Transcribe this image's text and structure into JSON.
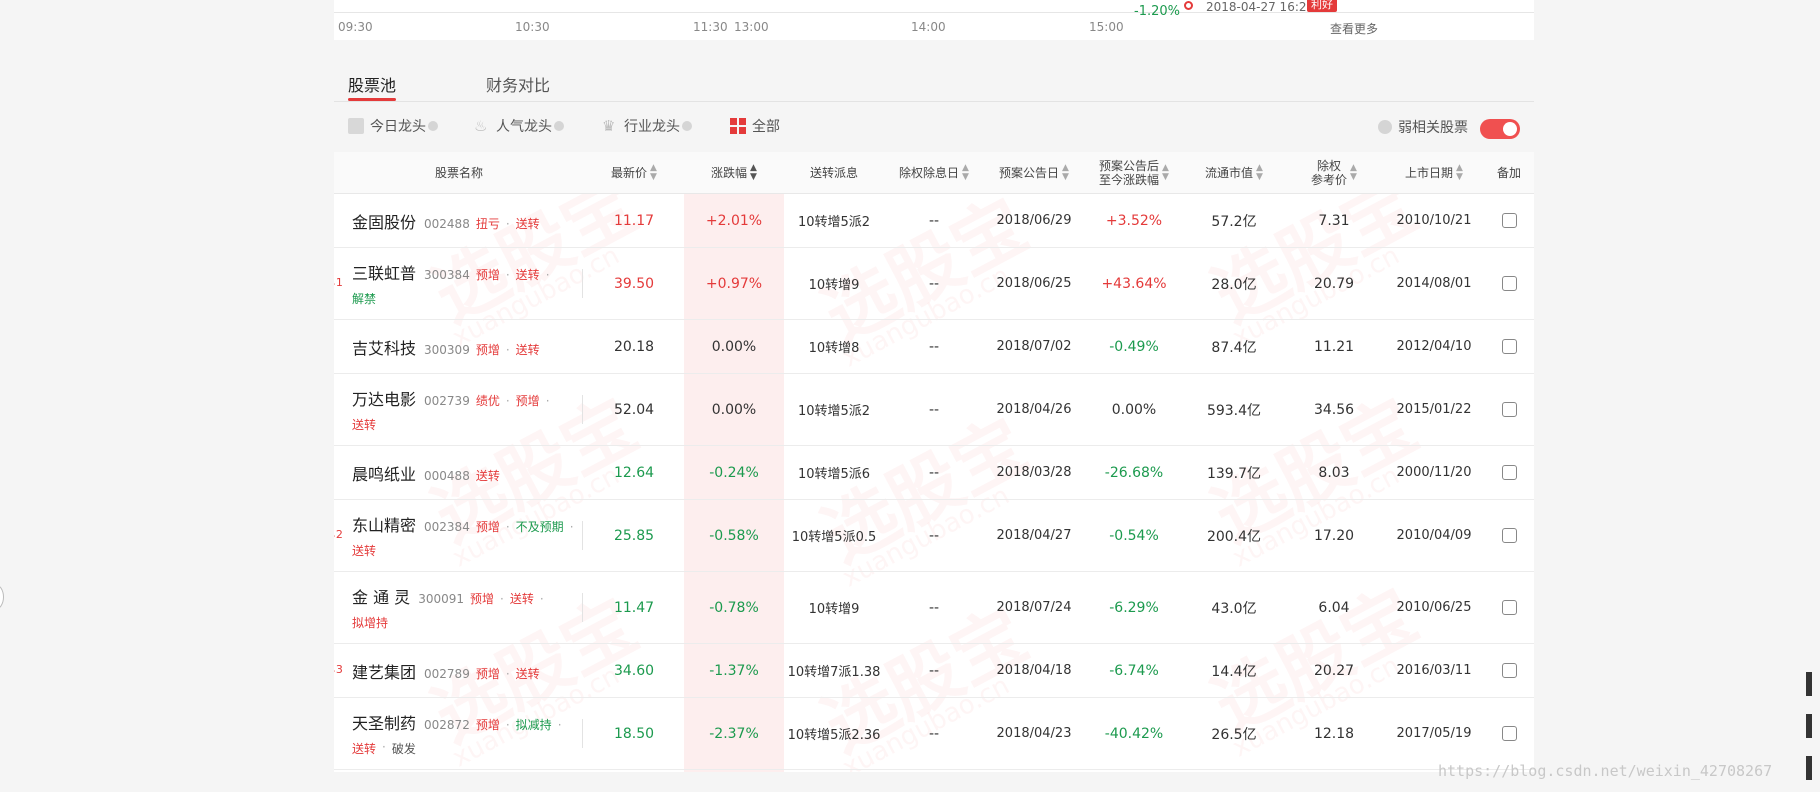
{
  "chart_strip": {
    "time_ticks": [
      "09:30",
      "10:30",
      "11:30",
      "13:00",
      "14:00",
      "15:00"
    ],
    "news": {
      "change": "-1.20%",
      "time": "2018-04-27 16:26",
      "badge": "利好"
    },
    "view_more": "查看更多"
  },
  "tabs": [
    {
      "label": "股票池",
      "active": true
    },
    {
      "label": "财务对比",
      "active": false
    }
  ],
  "filters": {
    "items": [
      {
        "label": "今日龙头",
        "icon": "box-icon"
      },
      {
        "label": "人气龙头",
        "icon": "flame-icon"
      },
      {
        "label": "行业龙头",
        "icon": "crown-icon"
      },
      {
        "label": "全部",
        "icon": "grid-icon"
      }
    ],
    "weak_label": "弱相关股票"
  },
  "table": {
    "headers": [
      "股票名称",
      "最新价",
      "涨跌幅",
      "送转派息",
      "除权除息日",
      "预案公告日",
      "预案公告后",
      "至今涨跌幅",
      "流通市值",
      "除权",
      "参考价",
      "上市日期",
      "备加"
    ],
    "rows": [
      {
        "name": "金固股份",
        "code": "002488",
        "tags": [
          {
            "t": "扭亏",
            "c": "red"
          },
          {
            "t": "送转",
            "c": "red"
          }
        ],
        "line2": [],
        "hot": "",
        "price": "11.17",
        "price_dir": "up",
        "change": "+2.01%",
        "change_dir": "up",
        "plan": "10转增5派2",
        "exdate": "--",
        "anndate": "2018/06/29",
        "since": "+3.52%",
        "since_dir": "up",
        "mcap": "57.2亿",
        "refprice": "7.31",
        "listdate": "2010/10/21"
      },
      {
        "name": "三联虹普",
        "code": "300384",
        "tags": [
          {
            "t": "预增",
            "c": "red"
          },
          {
            "t": "送转",
            "c": "red"
          }
        ],
        "line2": [
          {
            "t": "解禁",
            "c": "green"
          }
        ],
        "hot": "1",
        "price": "39.50",
        "price_dir": "up",
        "change": "+0.97%",
        "change_dir": "up",
        "plan": "10转增9",
        "exdate": "--",
        "anndate": "2018/06/25",
        "since": "+43.64%",
        "since_dir": "up",
        "mcap": "28.0亿",
        "refprice": "20.79",
        "listdate": "2014/08/01"
      },
      {
        "name": "吉艾科技",
        "code": "300309",
        "tags": [
          {
            "t": "预增",
            "c": "red"
          },
          {
            "t": "送转",
            "c": "red"
          }
        ],
        "line2": [],
        "hot": "",
        "price": "20.18",
        "price_dir": "flat",
        "change": "0.00%",
        "change_dir": "flat",
        "plan": "10转增8",
        "exdate": "--",
        "anndate": "2018/07/02",
        "since": "-0.49%",
        "since_dir": "down",
        "mcap": "87.4亿",
        "refprice": "11.21",
        "listdate": "2012/04/10"
      },
      {
        "name": "万达电影",
        "code": "002739",
        "tags": [
          {
            "t": "绩优",
            "c": "red"
          },
          {
            "t": "预增",
            "c": "red"
          }
        ],
        "line2": [
          {
            "t": "送转",
            "c": "red"
          }
        ],
        "hot": "",
        "price": "52.04",
        "price_dir": "flat",
        "change": "0.00%",
        "change_dir": "flat",
        "plan": "10转增5派2",
        "exdate": "--",
        "anndate": "2018/04/26",
        "since": "0.00%",
        "since_dir": "flat",
        "mcap": "593.4亿",
        "refprice": "34.56",
        "listdate": "2015/01/22"
      },
      {
        "name": "晨鸣纸业",
        "code": "000488",
        "tags": [
          {
            "t": "送转",
            "c": "red"
          }
        ],
        "line2": [],
        "hot": "",
        "price": "12.64",
        "price_dir": "down",
        "change": "-0.24%",
        "change_dir": "down",
        "plan": "10转增5派6",
        "exdate": "--",
        "anndate": "2018/03/28",
        "since": "-26.68%",
        "since_dir": "down",
        "mcap": "139.7亿",
        "refprice": "8.03",
        "listdate": "2000/11/20"
      },
      {
        "name": "东山精密",
        "code": "002384",
        "tags": [
          {
            "t": "预增",
            "c": "red"
          },
          {
            "t": "不及预期",
            "c": "green"
          }
        ],
        "line2": [
          {
            "t": "送转",
            "c": "red"
          }
        ],
        "hot": "2",
        "price": "25.85",
        "price_dir": "down",
        "change": "-0.58%",
        "change_dir": "down",
        "plan": "10转增5派0.5",
        "exdate": "--",
        "anndate": "2018/04/27",
        "since": "-0.54%",
        "since_dir": "down",
        "mcap": "200.4亿",
        "refprice": "17.20",
        "listdate": "2010/04/09"
      },
      {
        "name": "金 通 灵",
        "code": "300091",
        "tags": [
          {
            "t": "预增",
            "c": "red"
          },
          {
            "t": "送转",
            "c": "red"
          }
        ],
        "line2": [
          {
            "t": "拟增持",
            "c": "red"
          }
        ],
        "hot": "",
        "price": "11.47",
        "price_dir": "down",
        "change": "-0.78%",
        "change_dir": "down",
        "plan": "10转增9",
        "exdate": "--",
        "anndate": "2018/07/24",
        "since": "-6.29%",
        "since_dir": "down",
        "mcap": "43.0亿",
        "refprice": "6.04",
        "listdate": "2010/06/25"
      },
      {
        "name": "建艺集团",
        "code": "002789",
        "tags": [
          {
            "t": "预增",
            "c": "red"
          },
          {
            "t": "送转",
            "c": "red"
          }
        ],
        "line2": [],
        "hot": "3",
        "price": "34.60",
        "price_dir": "down",
        "change": "-1.37%",
        "change_dir": "down",
        "plan": "10转增7派1.38",
        "exdate": "--",
        "anndate": "2018/04/18",
        "since": "-6.74%",
        "since_dir": "down",
        "mcap": "14.4亿",
        "refprice": "20.27",
        "listdate": "2016/03/11"
      },
      {
        "name": "天圣制药",
        "code": "002872",
        "tags": [
          {
            "t": "预增",
            "c": "red"
          },
          {
            "t": "拟减持",
            "c": "green"
          }
        ],
        "line2": [
          {
            "t": "送转",
            "c": "red"
          },
          {
            "t": "破发",
            "c": "plain"
          }
        ],
        "hot": "",
        "price": "18.50",
        "price_dir": "down",
        "change": "-2.37%",
        "change_dir": "down",
        "plan": "10转增5派2.36",
        "exdate": "--",
        "anndate": "2018/04/23",
        "since": "-40.42%",
        "since_dir": "down",
        "mcap": "26.5亿",
        "refprice": "12.18",
        "listdate": "2017/05/19"
      }
    ]
  },
  "watermark": {
    "main": "选股宝",
    "sub": "xuangubao.cn"
  },
  "blog_url": "https://blog.csdn.net/weixin_42708267",
  "colors": {
    "up": "#e43a3a",
    "down": "#1c9a4e",
    "accent": "#e43a3a"
  }
}
